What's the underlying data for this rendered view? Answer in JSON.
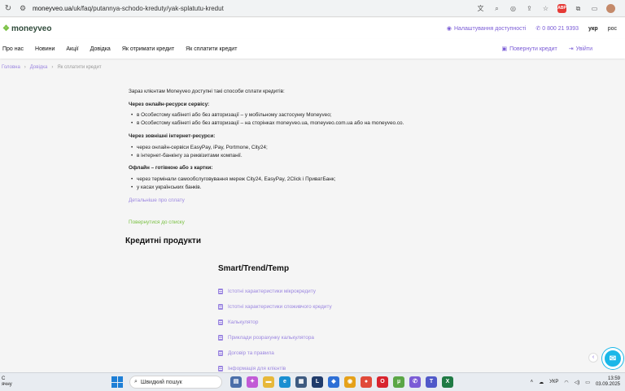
{
  "browser": {
    "url_domain": "moneyveo.ua",
    "url_path": "/uk/faq/putannya-schodo-kreduty/yak-splatutu-kredut",
    "extensions": [
      {
        "name": "translate-icon",
        "glyph": "文"
      },
      {
        "name": "zoom-icon",
        "glyph": "⌕"
      },
      {
        "name": "eye-off-icon",
        "glyph": "◎"
      },
      {
        "name": "share-icon",
        "glyph": "⇪"
      },
      {
        "name": "bookmark-star-icon",
        "glyph": "☆"
      },
      {
        "name": "adblock-icon",
        "glyph": "ABP"
      },
      {
        "name": "extensions-icon",
        "glyph": "⧉"
      },
      {
        "name": "side-panel-icon",
        "glyph": "▭"
      },
      {
        "name": "profile-avatar",
        "glyph": ""
      }
    ]
  },
  "header": {
    "logo_text": "moneyveo",
    "accessibility_label": "Налаштування доступності",
    "phone": "0 800 21 9393",
    "lang_uk": "укр",
    "lang_ru": "рос"
  },
  "nav": {
    "items": [
      "Про нас",
      "Новини",
      "Акції",
      "Довідка",
      "Як отримати кредит",
      "Як сплатити кредит"
    ],
    "repay_label": "Повернути кредит",
    "login_label": "Увійти"
  },
  "breadcrumb": {
    "home": "Головна",
    "help": "Довідка",
    "current": "Як сплатити кредит"
  },
  "content": {
    "intro": "Зараз клієнтам Moneyveo доступні такі способи сплати кредитів:",
    "sections": [
      {
        "head": "Через онлайн-ресурси сервісу:",
        "items": [
          "в Особистому кабінеті або без авторизації – у мобільному застосунку Moneyveo;",
          "в Особистому кабінеті або без авторизації – на сторінках moneyveo.ua, moneyveo.com.ua або на moneyveo.co."
        ]
      },
      {
        "head": "Через зовнішні інтернет-ресурси:",
        "items": [
          "через онлайн-сервіси EasyPay, iPay, Portmone, City24;",
          "в інтернет-банкінгу за реквізитами компанії."
        ]
      },
      {
        "head": "Офлайн – готівкою або з картки:",
        "items": [
          "через термінали самообслуговування мереж City24, EasyPay, 2Click і ПриватБанк;",
          "у касах українських банків."
        ]
      }
    ],
    "detail_link": "Детальніше про сплату",
    "back_link": "Повернутися до списку"
  },
  "products": {
    "title": "Кредитні продукти",
    "subtitle": "Smart/Trend/Temp",
    "docs": [
      "Істотні характеристики мікрокредиту",
      "Істотні характеристики споживчого кредиту",
      "Калькулятор",
      "Приклади розрахунку калькулятора",
      "Договір та правила",
      "Інформація для клієнтів"
    ]
  },
  "taskbar": {
    "weather_line1": "C",
    "weather_line2": "ячну",
    "search_placeholder": "Швидкий пошук",
    "lang": "УКР",
    "time": "13:59",
    "date": "03.09.2025",
    "apps": [
      {
        "name": "file-explorer-icon",
        "color": "#4a6ea9",
        "glyph": "▤"
      },
      {
        "name": "copilot-icon",
        "color": "#c25bd6",
        "glyph": "✦"
      },
      {
        "name": "folder-icon",
        "color": "#e7b83a",
        "glyph": "▬"
      },
      {
        "name": "edge-icon",
        "color": "#1a8fd1",
        "glyph": "e"
      },
      {
        "name": "store-icon",
        "color": "#3d5a80",
        "glyph": "▦"
      },
      {
        "name": "app-l-icon",
        "color": "#1f3b6b",
        "glyph": "L"
      },
      {
        "name": "dropbox-icon",
        "color": "#2d6fd6",
        "glyph": "◆"
      },
      {
        "name": "chrome-icon",
        "color": "#e5a11a",
        "glyph": "◉"
      },
      {
        "name": "app-red-icon",
        "color": "#e04a3a",
        "glyph": "●"
      },
      {
        "name": "opera-icon",
        "color": "#d8242f",
        "glyph": "O"
      },
      {
        "name": "torrent-icon",
        "color": "#5aa646",
        "glyph": "µ"
      },
      {
        "name": "viber-icon",
        "color": "#7b5cd6",
        "glyph": "✆"
      },
      {
        "name": "teams-icon",
        "color": "#5059c9",
        "glyph": "T"
      },
      {
        "name": "excel-icon",
        "color": "#1f7a44",
        "glyph": "X"
      }
    ]
  }
}
